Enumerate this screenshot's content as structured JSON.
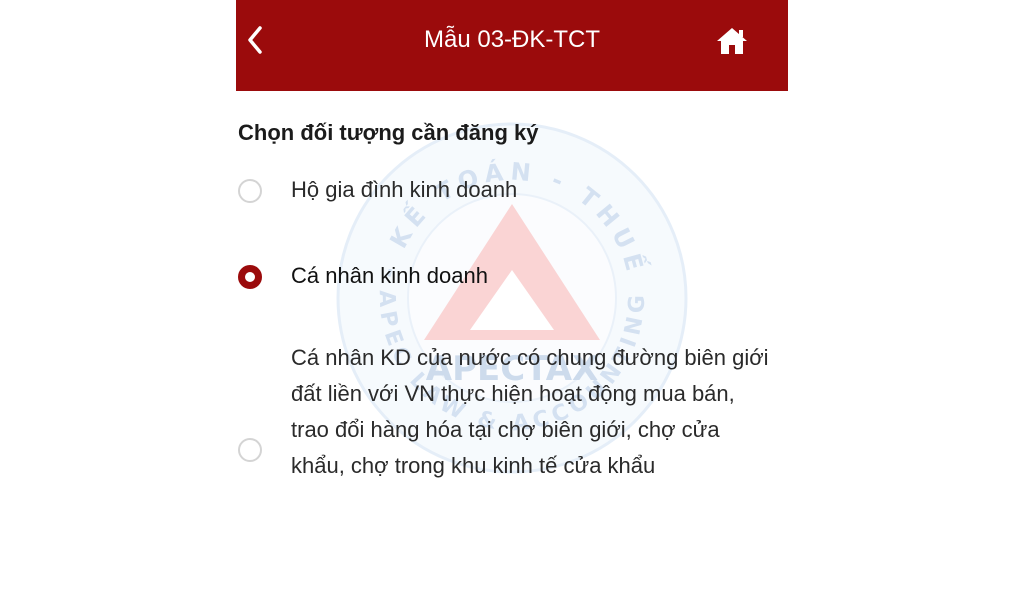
{
  "header": {
    "title": "Mẫu 03-ĐK-TCT",
    "back_icon": "chevron-left-icon",
    "home_icon": "home-icon",
    "background_color": "#9b0b0c"
  },
  "form": {
    "section_title": "Chọn đối tượng cần đăng ký",
    "options": [
      {
        "label": "Hộ gia đình kinh doanh",
        "selected": false
      },
      {
        "label": "Cá nhân kinh doanh",
        "selected": true
      },
      {
        "label": "Cá nhân KD của nước có chung đường biên giới đất liền với VN thực hiện hoạt động mua bán, trao đổi hàng hóa tại chợ biên giới, chợ cửa khẩu, chợ trong khu kinh tế cửa khẩu",
        "selected": false
      }
    ]
  },
  "watermark": {
    "top_text": "LUẬT - KẾ TOÁN - THUẾ APEC",
    "bottom_text": "APEC LAW & ACCOUNTING",
    "name": "APECTAX"
  }
}
